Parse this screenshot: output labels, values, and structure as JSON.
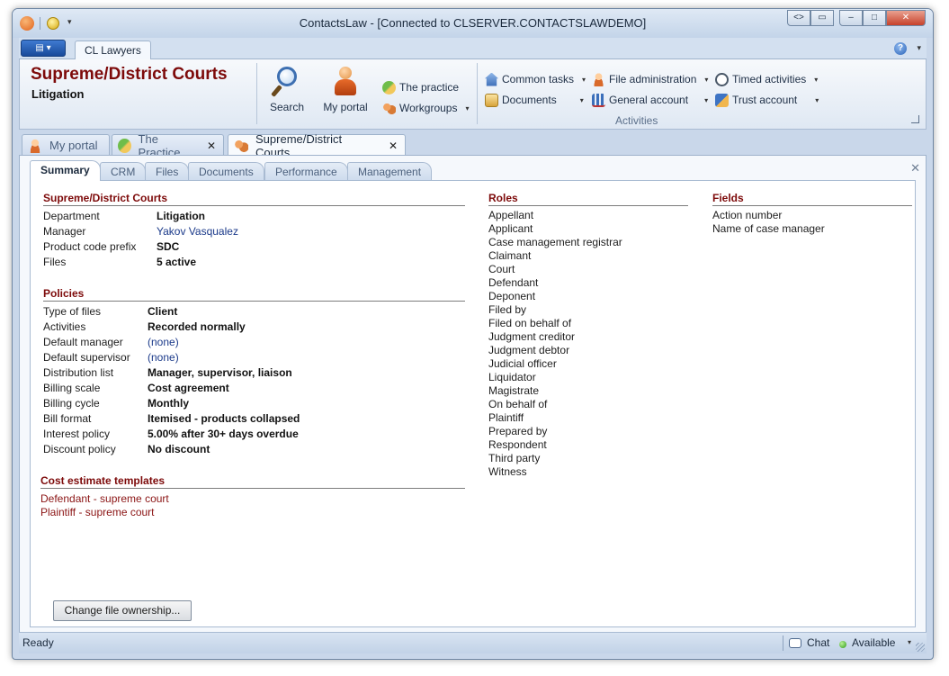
{
  "window": {
    "title": "ContactsLaw - [Connected to CLSERVER.CONTACTSLAWDEMO]",
    "controls": {
      "extra1": "<>",
      "extra2": "▭",
      "minimize": "–",
      "maximize": "□",
      "close": "✕"
    }
  },
  "ribbon_tabs": {
    "app_menu": "▤ ▾",
    "active_tab": "CL Lawyers",
    "help": "?"
  },
  "ribbon": {
    "title": "Supreme/District Courts",
    "subtitle": "Litigation",
    "buttons": {
      "search": "Search",
      "my_portal": "My portal",
      "the_practice": "The practice",
      "workgroups": "Workgroups",
      "common_tasks": "Common tasks",
      "documents": "Documents",
      "file_administration": "File administration",
      "general_account": "General account",
      "timed_activities": "Timed activities",
      "trust_account": "Trust account"
    },
    "group_label": "Activities"
  },
  "doc_tabs": [
    {
      "label": "My portal",
      "icon": "person-icon",
      "active": false
    },
    {
      "label": "The Practice",
      "icon": "practice-icon",
      "active": false
    },
    {
      "label": "Supreme/District Courts",
      "icon": "workgroup-icon",
      "active": true
    }
  ],
  "sub_tabs": [
    "Summary",
    "CRM",
    "Files",
    "Documents",
    "Performance",
    "Management"
  ],
  "summary": {
    "section_title": "Supreme/District Courts",
    "fields": [
      {
        "label": "Department",
        "value": "Litigation",
        "style": "bold"
      },
      {
        "label": "Manager",
        "value": "Yakov Vasqualez",
        "style": "link"
      },
      {
        "label": "Product code prefix",
        "value": "SDC",
        "style": "bold"
      },
      {
        "label": "Files",
        "value": "5 active",
        "style": "bold"
      }
    ]
  },
  "policies": {
    "title": "Policies",
    "fields": [
      {
        "label": "Type of files",
        "value": "Client",
        "style": "bold"
      },
      {
        "label": "Activities",
        "value": "Recorded normally",
        "style": "bold"
      },
      {
        "label": "Default manager",
        "value": "(none)",
        "style": "link"
      },
      {
        "label": "Default supervisor",
        "value": "(none)",
        "style": "link"
      },
      {
        "label": "Distribution list",
        "value": "Manager, supervisor, liaison",
        "style": "bold"
      },
      {
        "label": "Billing scale",
        "value": "Cost agreement",
        "style": "bold"
      },
      {
        "label": "Billing cycle",
        "value": "Monthly",
        "style": "bold"
      },
      {
        "label": "Bill format",
        "value": "Itemised - products collapsed",
        "style": "bold"
      },
      {
        "label": "Interest policy",
        "value": "5.00% after 30+ days overdue",
        "style": "bold"
      },
      {
        "label": "Discount policy",
        "value": "No discount",
        "style": "bold"
      }
    ]
  },
  "cost_estimates": {
    "title": "Cost estimate templates",
    "items": [
      "Defendant - supreme court",
      "Plaintiff - supreme court"
    ]
  },
  "roles": {
    "title": "Roles",
    "items": [
      "Appellant",
      "Applicant",
      "Case management registrar",
      "Claimant",
      "Court",
      "Defendant",
      "Deponent",
      "Filed by",
      "Filed on behalf of",
      "Judgment creditor",
      "Judgment debtor",
      "Judicial officer",
      "Liquidator",
      "Magistrate",
      "On behalf of",
      "Plaintiff",
      "Prepared by",
      "Respondent",
      "Third party",
      "Witness"
    ]
  },
  "fields_section": {
    "title": "Fields",
    "items": [
      "Action number",
      "Name of case manager"
    ]
  },
  "change_ownership_button": "Change file ownership...",
  "status": {
    "text": "Ready",
    "chat": "Chat",
    "availability": "Available"
  },
  "colors": {
    "accent_maroon": "#7d0a0a",
    "link_blue": "#1b3a8a",
    "chrome_blue": "#c9d7ea"
  }
}
